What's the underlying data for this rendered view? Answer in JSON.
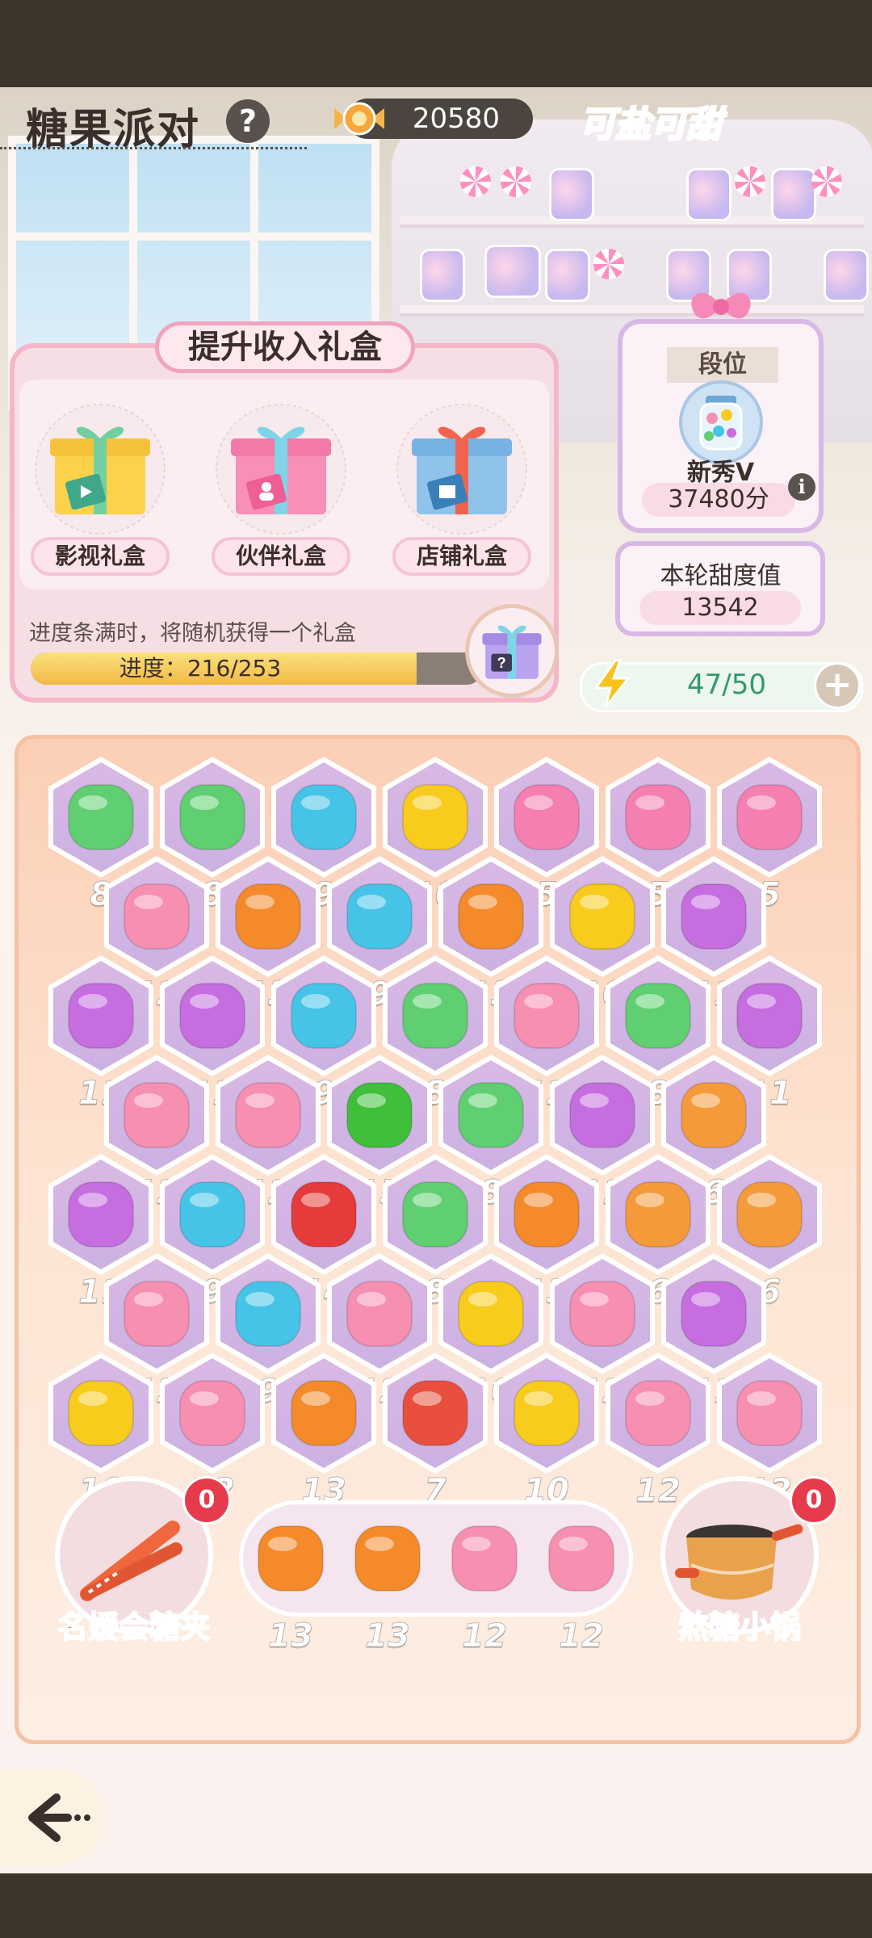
{
  "header": {
    "title": "糖果派对",
    "help_label": "?",
    "candy_count": "20580",
    "logo_text": "可盐可甜"
  },
  "gift_panel": {
    "title": "提升收入礼盒",
    "boxes": [
      {
        "label": "影视礼盒",
        "icon": "film-gift-icon"
      },
      {
        "label": "伙伴礼盒",
        "icon": "partner-gift-icon"
      },
      {
        "label": "店铺礼盒",
        "icon": "shop-gift-icon"
      }
    ],
    "progress_hint": "进度条满时，将随机获得一个礼盒",
    "progress_label": "进度：216/253",
    "progress_current": 216,
    "progress_total": 253
  },
  "rank": {
    "label": "段位",
    "name": "新秀V",
    "score": "37480分",
    "info_label": "i"
  },
  "sweetness": {
    "label": "本轮甜度值",
    "value": "13542"
  },
  "energy": {
    "value": "47/50",
    "plus_label": "+"
  },
  "board": {
    "rows": [
      [
        8,
        8,
        9,
        10,
        5,
        5,
        5
      ],
      [
        12,
        13,
        9,
        13,
        10,
        11
      ],
      [
        11,
        11,
        9,
        8,
        12,
        8,
        11
      ],
      [
        12,
        12,
        15,
        8,
        11,
        6
      ],
      [
        11,
        9,
        14,
        8,
        13,
        6,
        6
      ],
      [
        12,
        9,
        12,
        10,
        12,
        11
      ],
      [
        10,
        12,
        13,
        7,
        10,
        12,
        12
      ]
    ],
    "candy_colors": {
      "5": "#f57fb0",
      "6": "#f59a3a",
      "7": "#e8503d",
      "8": "#5fcf72",
      "9": "#46c4e8",
      "10": "#f7cc1d",
      "11": "#c66ee0",
      "12": "#f78fb1",
      "13": "#f58a2a",
      "14": "#e53b3b",
      "15": "#3fbf3a"
    }
  },
  "tray": {
    "items": [
      13,
      13,
      12,
      12
    ]
  },
  "tools": [
    {
      "label": "名媛会糖夹",
      "count": "0",
      "icon": "candy-tongs-icon"
    },
    {
      "label": "熬糖小锅",
      "count": "0",
      "icon": "cooking-pot-icon"
    }
  ],
  "nav": {
    "back_icon": "back-arrow-icon"
  }
}
